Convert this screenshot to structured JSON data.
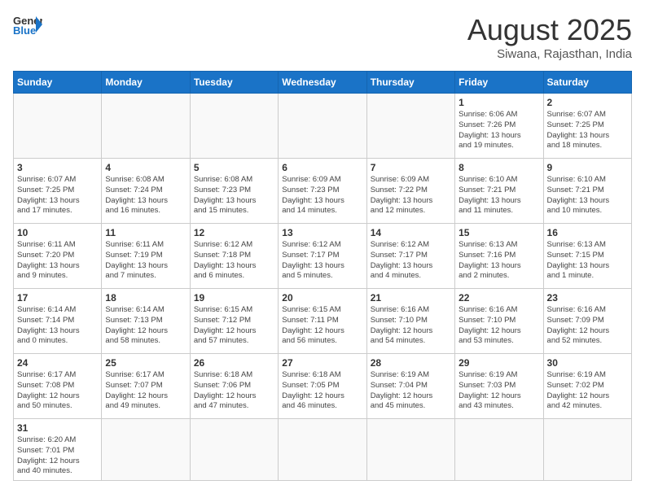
{
  "header": {
    "logo_general": "General",
    "logo_blue": "Blue",
    "title": "August 2025",
    "subtitle": "Siwana, Rajasthan, India"
  },
  "weekdays": [
    "Sunday",
    "Monday",
    "Tuesday",
    "Wednesday",
    "Thursday",
    "Friday",
    "Saturday"
  ],
  "weeks": [
    [
      {
        "day": "",
        "info": ""
      },
      {
        "day": "",
        "info": ""
      },
      {
        "day": "",
        "info": ""
      },
      {
        "day": "",
        "info": ""
      },
      {
        "day": "",
        "info": ""
      },
      {
        "day": "1",
        "info": "Sunrise: 6:06 AM\nSunset: 7:26 PM\nDaylight: 13 hours\nand 19 minutes."
      },
      {
        "day": "2",
        "info": "Sunrise: 6:07 AM\nSunset: 7:25 PM\nDaylight: 13 hours\nand 18 minutes."
      }
    ],
    [
      {
        "day": "3",
        "info": "Sunrise: 6:07 AM\nSunset: 7:25 PM\nDaylight: 13 hours\nand 17 minutes."
      },
      {
        "day": "4",
        "info": "Sunrise: 6:08 AM\nSunset: 7:24 PM\nDaylight: 13 hours\nand 16 minutes."
      },
      {
        "day": "5",
        "info": "Sunrise: 6:08 AM\nSunset: 7:23 PM\nDaylight: 13 hours\nand 15 minutes."
      },
      {
        "day": "6",
        "info": "Sunrise: 6:09 AM\nSunset: 7:23 PM\nDaylight: 13 hours\nand 14 minutes."
      },
      {
        "day": "7",
        "info": "Sunrise: 6:09 AM\nSunset: 7:22 PM\nDaylight: 13 hours\nand 12 minutes."
      },
      {
        "day": "8",
        "info": "Sunrise: 6:10 AM\nSunset: 7:21 PM\nDaylight: 13 hours\nand 11 minutes."
      },
      {
        "day": "9",
        "info": "Sunrise: 6:10 AM\nSunset: 7:21 PM\nDaylight: 13 hours\nand 10 minutes."
      }
    ],
    [
      {
        "day": "10",
        "info": "Sunrise: 6:11 AM\nSunset: 7:20 PM\nDaylight: 13 hours\nand 9 minutes."
      },
      {
        "day": "11",
        "info": "Sunrise: 6:11 AM\nSunset: 7:19 PM\nDaylight: 13 hours\nand 7 minutes."
      },
      {
        "day": "12",
        "info": "Sunrise: 6:12 AM\nSunset: 7:18 PM\nDaylight: 13 hours\nand 6 minutes."
      },
      {
        "day": "13",
        "info": "Sunrise: 6:12 AM\nSunset: 7:17 PM\nDaylight: 13 hours\nand 5 minutes."
      },
      {
        "day": "14",
        "info": "Sunrise: 6:12 AM\nSunset: 7:17 PM\nDaylight: 13 hours\nand 4 minutes."
      },
      {
        "day": "15",
        "info": "Sunrise: 6:13 AM\nSunset: 7:16 PM\nDaylight: 13 hours\nand 2 minutes."
      },
      {
        "day": "16",
        "info": "Sunrise: 6:13 AM\nSunset: 7:15 PM\nDaylight: 13 hours\nand 1 minute."
      }
    ],
    [
      {
        "day": "17",
        "info": "Sunrise: 6:14 AM\nSunset: 7:14 PM\nDaylight: 13 hours\nand 0 minutes."
      },
      {
        "day": "18",
        "info": "Sunrise: 6:14 AM\nSunset: 7:13 PM\nDaylight: 12 hours\nand 58 minutes."
      },
      {
        "day": "19",
        "info": "Sunrise: 6:15 AM\nSunset: 7:12 PM\nDaylight: 12 hours\nand 57 minutes."
      },
      {
        "day": "20",
        "info": "Sunrise: 6:15 AM\nSunset: 7:11 PM\nDaylight: 12 hours\nand 56 minutes."
      },
      {
        "day": "21",
        "info": "Sunrise: 6:16 AM\nSunset: 7:10 PM\nDaylight: 12 hours\nand 54 minutes."
      },
      {
        "day": "22",
        "info": "Sunrise: 6:16 AM\nSunset: 7:10 PM\nDaylight: 12 hours\nand 53 minutes."
      },
      {
        "day": "23",
        "info": "Sunrise: 6:16 AM\nSunset: 7:09 PM\nDaylight: 12 hours\nand 52 minutes."
      }
    ],
    [
      {
        "day": "24",
        "info": "Sunrise: 6:17 AM\nSunset: 7:08 PM\nDaylight: 12 hours\nand 50 minutes."
      },
      {
        "day": "25",
        "info": "Sunrise: 6:17 AM\nSunset: 7:07 PM\nDaylight: 12 hours\nand 49 minutes."
      },
      {
        "day": "26",
        "info": "Sunrise: 6:18 AM\nSunset: 7:06 PM\nDaylight: 12 hours\nand 47 minutes."
      },
      {
        "day": "27",
        "info": "Sunrise: 6:18 AM\nSunset: 7:05 PM\nDaylight: 12 hours\nand 46 minutes."
      },
      {
        "day": "28",
        "info": "Sunrise: 6:19 AM\nSunset: 7:04 PM\nDaylight: 12 hours\nand 45 minutes."
      },
      {
        "day": "29",
        "info": "Sunrise: 6:19 AM\nSunset: 7:03 PM\nDaylight: 12 hours\nand 43 minutes."
      },
      {
        "day": "30",
        "info": "Sunrise: 6:19 AM\nSunset: 7:02 PM\nDaylight: 12 hours\nand 42 minutes."
      }
    ],
    [
      {
        "day": "31",
        "info": "Sunrise: 6:20 AM\nSunset: 7:01 PM\nDaylight: 12 hours\nand 40 minutes."
      },
      {
        "day": "",
        "info": ""
      },
      {
        "day": "",
        "info": ""
      },
      {
        "day": "",
        "info": ""
      },
      {
        "day": "",
        "info": ""
      },
      {
        "day": "",
        "info": ""
      },
      {
        "day": "",
        "info": ""
      }
    ]
  ]
}
